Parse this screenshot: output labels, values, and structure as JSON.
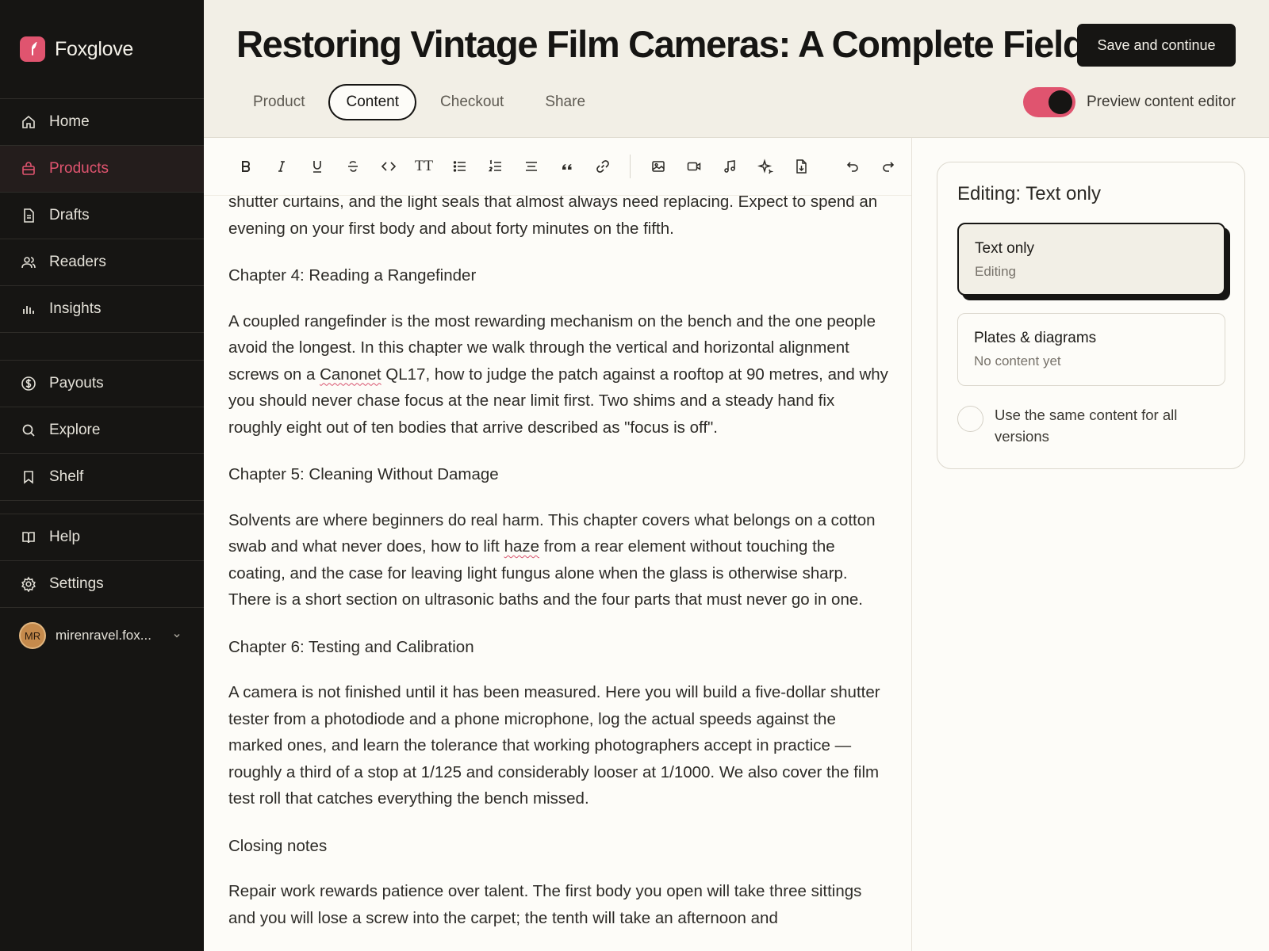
{
  "brand": {
    "name": "Foxglove",
    "accent": "#e0546f"
  },
  "sidebar": {
    "items": [
      {
        "label": "Home",
        "icon": "home-icon"
      },
      {
        "label": "Products",
        "icon": "shopping-bag-icon",
        "active": true
      },
      {
        "label": "Drafts",
        "icon": "document-icon"
      },
      {
        "label": "Readers",
        "icon": "users-icon"
      },
      {
        "label": "Insights",
        "icon": "bar-chart-icon"
      },
      {
        "label": "Payouts",
        "icon": "dollar-circle-icon"
      },
      {
        "label": "Explore",
        "icon": "search-icon"
      },
      {
        "label": "Shelf",
        "icon": "bookmark-icon"
      },
      {
        "label": "Help",
        "icon": "book-open-icon"
      },
      {
        "label": "Settings",
        "icon": "gear-icon"
      }
    ],
    "user": {
      "initials": "MR",
      "name": "mirenravel.fox..."
    }
  },
  "header": {
    "title": "Restoring Vintage Film Cameras: A Complete Field...",
    "save_label": "Save and continue",
    "tabs": [
      {
        "label": "Product"
      },
      {
        "label": "Content",
        "active": true
      },
      {
        "label": "Checkout"
      },
      {
        "label": "Share"
      }
    ],
    "preview_toggle": {
      "label": "Preview content editor",
      "on": true
    }
  },
  "toolbar": {
    "tools": [
      "bold-icon",
      "italic-icon",
      "underline-icon",
      "strikethrough-icon",
      "code-icon",
      "text-size-icon",
      "bullet-list-icon",
      "numbered-list-icon",
      "align-icon",
      "quote-icon",
      "link-icon",
      "image-icon",
      "video-icon",
      "music-icon",
      "sparkle-icon",
      "file-icon",
      "undo-icon",
      "redo-icon"
    ],
    "text_size_glyph": "TT"
  },
  "document": {
    "p0": "shutter curtains, and the light seals that almost always need replacing. Expect to spend an evening on your first body and about forty minutes on the fifth.",
    "h4": "Chapter 4: Reading a Rangefinder",
    "p4a": "A coupled rangefinder is the most rewarding mechanism on the bench and the one people avoid the longest. In this chapter we walk through the vertical and horizontal alignment screws on a ",
    "p4_flag": "Canonet",
    "p4b": " QL17, how to judge the patch against a rooftop at 90 metres, and why you should never chase focus at the near limit first. Two shims and a steady hand fix roughly eight out of ten bodies that arrive described as \"focus is off\".",
    "h5": "Chapter 5: Cleaning Without Damage",
    "p5a": "Solvents are where beginners do real harm. This chapter covers what belongs on a cotton swab and what never does, how to lift ",
    "p5_flag": "haze",
    "p5b": " from a rear element without touching the coating, and the case for leaving light fungus alone when the glass is otherwise sharp. There is a short section on ultrasonic baths and the four parts that must never go in one.",
    "h6": "Chapter 6: Testing and Calibration",
    "p6": "A camera is not finished until it has been measured. Here you will build a five-dollar shutter tester from a photodiode and a phone microphone, log the actual speeds against the marked ones, and learn the tolerance that working photographers accept in practice — roughly a third of a stop at 1/125 and considerably looser at 1/1000. We also cover the film test roll that catches everything the bench missed.",
    "h7": "Closing notes",
    "p7": "Repair work rewards patience over talent. The first body you open will take three sittings and you will lose a screw into the carpet; the tenth will take an afternoon and"
  },
  "panel": {
    "title": "Editing: Text only",
    "options": [
      {
        "title": "Text only",
        "subtitle": "Editing",
        "selected": true
      },
      {
        "title": "Plates & diagrams",
        "subtitle": "No content yet"
      }
    ],
    "same_content_label": "Use the same content for all versions"
  }
}
